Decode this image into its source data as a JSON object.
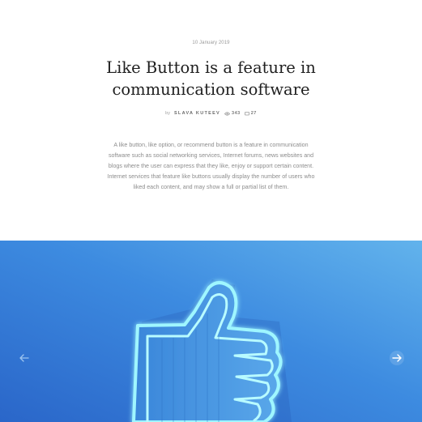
{
  "article": {
    "date": "10 January 2019",
    "title": "Like Button is a feature in communication software",
    "byline_prefix": "by",
    "author": "SLAVA KUTEEV",
    "views": "343",
    "comments": "27",
    "excerpt": "A like button, like option, or recommend button is a feature in communication software such as social networking services, Internet forums, news websites and blogs where the user can express that they like, enjoy or support certain content. Internet services that feature like buttons usually display the number of users who liked each content, and may show a full or partial list of them."
  },
  "hero": {
    "image": "neon-thumbs-up-icon",
    "colors": {
      "bg_dark": "#2f74d4",
      "bg_light": "#5fb0ea",
      "neon": "#8ff2ff"
    }
  },
  "carousel": {
    "prev_icon": "arrow-left-icon",
    "next_icon": "arrow-right-icon"
  }
}
